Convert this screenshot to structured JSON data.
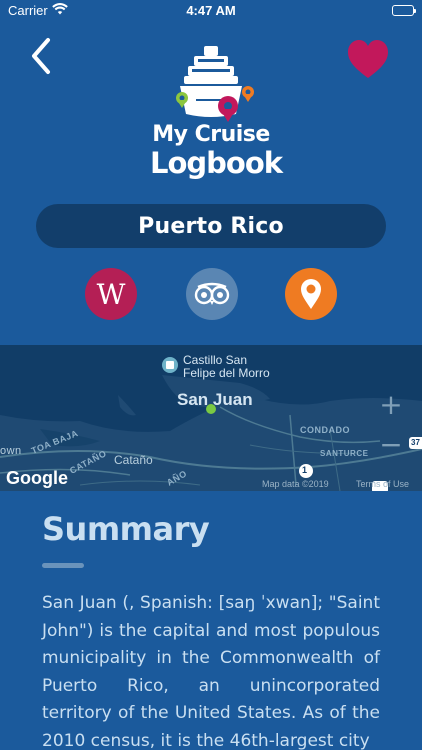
{
  "status_bar": {
    "carrier": "Carrier",
    "time": "4:47 AM"
  },
  "icons": {
    "back": "chevron-left-icon",
    "favorite": "heart-icon",
    "wifi": "wifi-icon",
    "battery": "battery-icon"
  },
  "logo": {
    "line1": "My Cruise",
    "line2": "Logbook"
  },
  "location": {
    "name": "Puerto Rico"
  },
  "actions": {
    "wikipedia_glyph": "W"
  },
  "map": {
    "place_line1": "Castillo San",
    "place_line2": "Felipe del Morro",
    "city": "San Juan",
    "label_toa_baja": "TOA BAJA",
    "label_catano_caps": "CATAÑO",
    "label_catano": "Cataño",
    "label_town": "own",
    "label_ano": "AÑO",
    "label_condado": "CONDADO",
    "label_santurce": "SANTURCE",
    "route_1": "1",
    "route_37": "37",
    "zoom_in": "+",
    "zoom_out": "−",
    "brand": "Google",
    "copyright": "Map data ©2019",
    "terms": "Terms of Use"
  },
  "summary": {
    "title": "Summary",
    "text": "San Juan (, Spanish: [saŋ ˈxwan]; \"Saint John\") is the capital and most populous municipality in the Commonwealth of Puerto Rico, an unincorporated territory of the United States. As of the 2010 census, it is the 46th-largest city"
  },
  "colors": {
    "background": "#1b5a9c",
    "pill": "#123e6b",
    "heart": "#c2185b",
    "wikipedia": "#b41f55",
    "tripadvisor": "#5a86b3",
    "maps": "#ef7b22",
    "summary_text": "#c9dff1"
  }
}
